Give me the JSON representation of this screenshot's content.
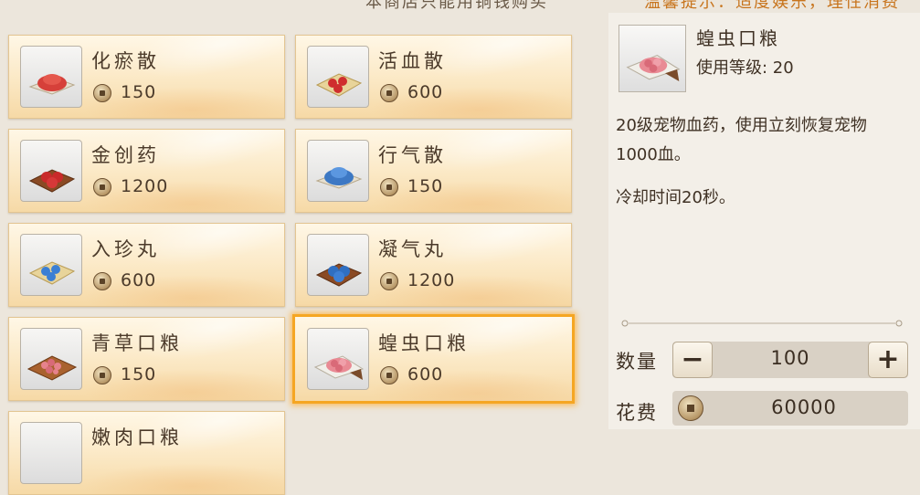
{
  "top_notes": {
    "left": "本商店只能用铜钱购买",
    "right": "温馨提示：适度娱乐，理性消费"
  },
  "items": [
    {
      "name": "化瘀散",
      "price": "150",
      "icon": "red-powder-pile-icon"
    },
    {
      "name": "活血散",
      "price": "600",
      "icon": "red-pills-plate-icon"
    },
    {
      "name": "金创药",
      "price": "1200",
      "icon": "red-pills-tray-icon"
    },
    {
      "name": "行气散",
      "price": "150",
      "icon": "blue-powder-pile-icon"
    },
    {
      "name": "入珍丸",
      "price": "600",
      "icon": "blue-pills-plate-icon"
    },
    {
      "name": "凝气丸",
      "price": "1200",
      "icon": "blue-pills-tray-icon"
    },
    {
      "name": "青草口粮",
      "price": "150",
      "icon": "pink-feed-tray-icon"
    },
    {
      "name": "蝗虫口粮",
      "price": "600",
      "icon": "pink-feed-cloth-icon"
    },
    {
      "name": "嫩肉口粮",
      "price": "",
      "icon": "feed-icon"
    }
  ],
  "selected_index": 7,
  "detail": {
    "name": "蝗虫口粮",
    "level": "使用等级: 20",
    "description": "20级宠物血药，使用立刻恢复宠物1000血。",
    "cooldown": "冷却时间20秒。",
    "icon": "pink-feed-cloth-icon"
  },
  "purchase": {
    "quantity_label": "数量",
    "quantity": "100",
    "minus": "−",
    "plus": "+",
    "cost_label": "花费",
    "cost": "60000"
  },
  "colors": {
    "selected_border": "#f5a623",
    "card_background": "#fbe8c4",
    "text": "#4b3a2a"
  }
}
